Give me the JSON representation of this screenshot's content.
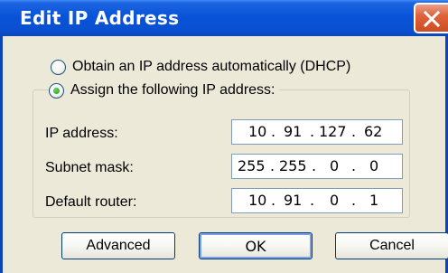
{
  "window": {
    "title": "Edit IP Address"
  },
  "mode_options": [
    {
      "label": "Obtain an IP address automatically (DHCP)",
      "selected": false
    },
    {
      "label": "Assign the following IP address:",
      "selected": true
    }
  ],
  "fields": {
    "ip_address": {
      "label": "IP address:",
      "octets": [
        "10",
        "91",
        "127",
        "62"
      ]
    },
    "subnet_mask": {
      "label": "Subnet mask:",
      "octets": [
        "255",
        "255",
        "0",
        "0"
      ]
    },
    "default_router": {
      "label": "Default router:",
      "octets": [
        "10",
        "91",
        "0",
        "1"
      ]
    }
  },
  "buttons": {
    "advanced": "Advanced",
    "ok": "OK",
    "cancel": "Cancel"
  },
  "colors": {
    "titlebar": "#0853d9",
    "dialog_bg": "#ece9d8",
    "close_button": "#e0633b",
    "radio_selected": "#21a121"
  }
}
